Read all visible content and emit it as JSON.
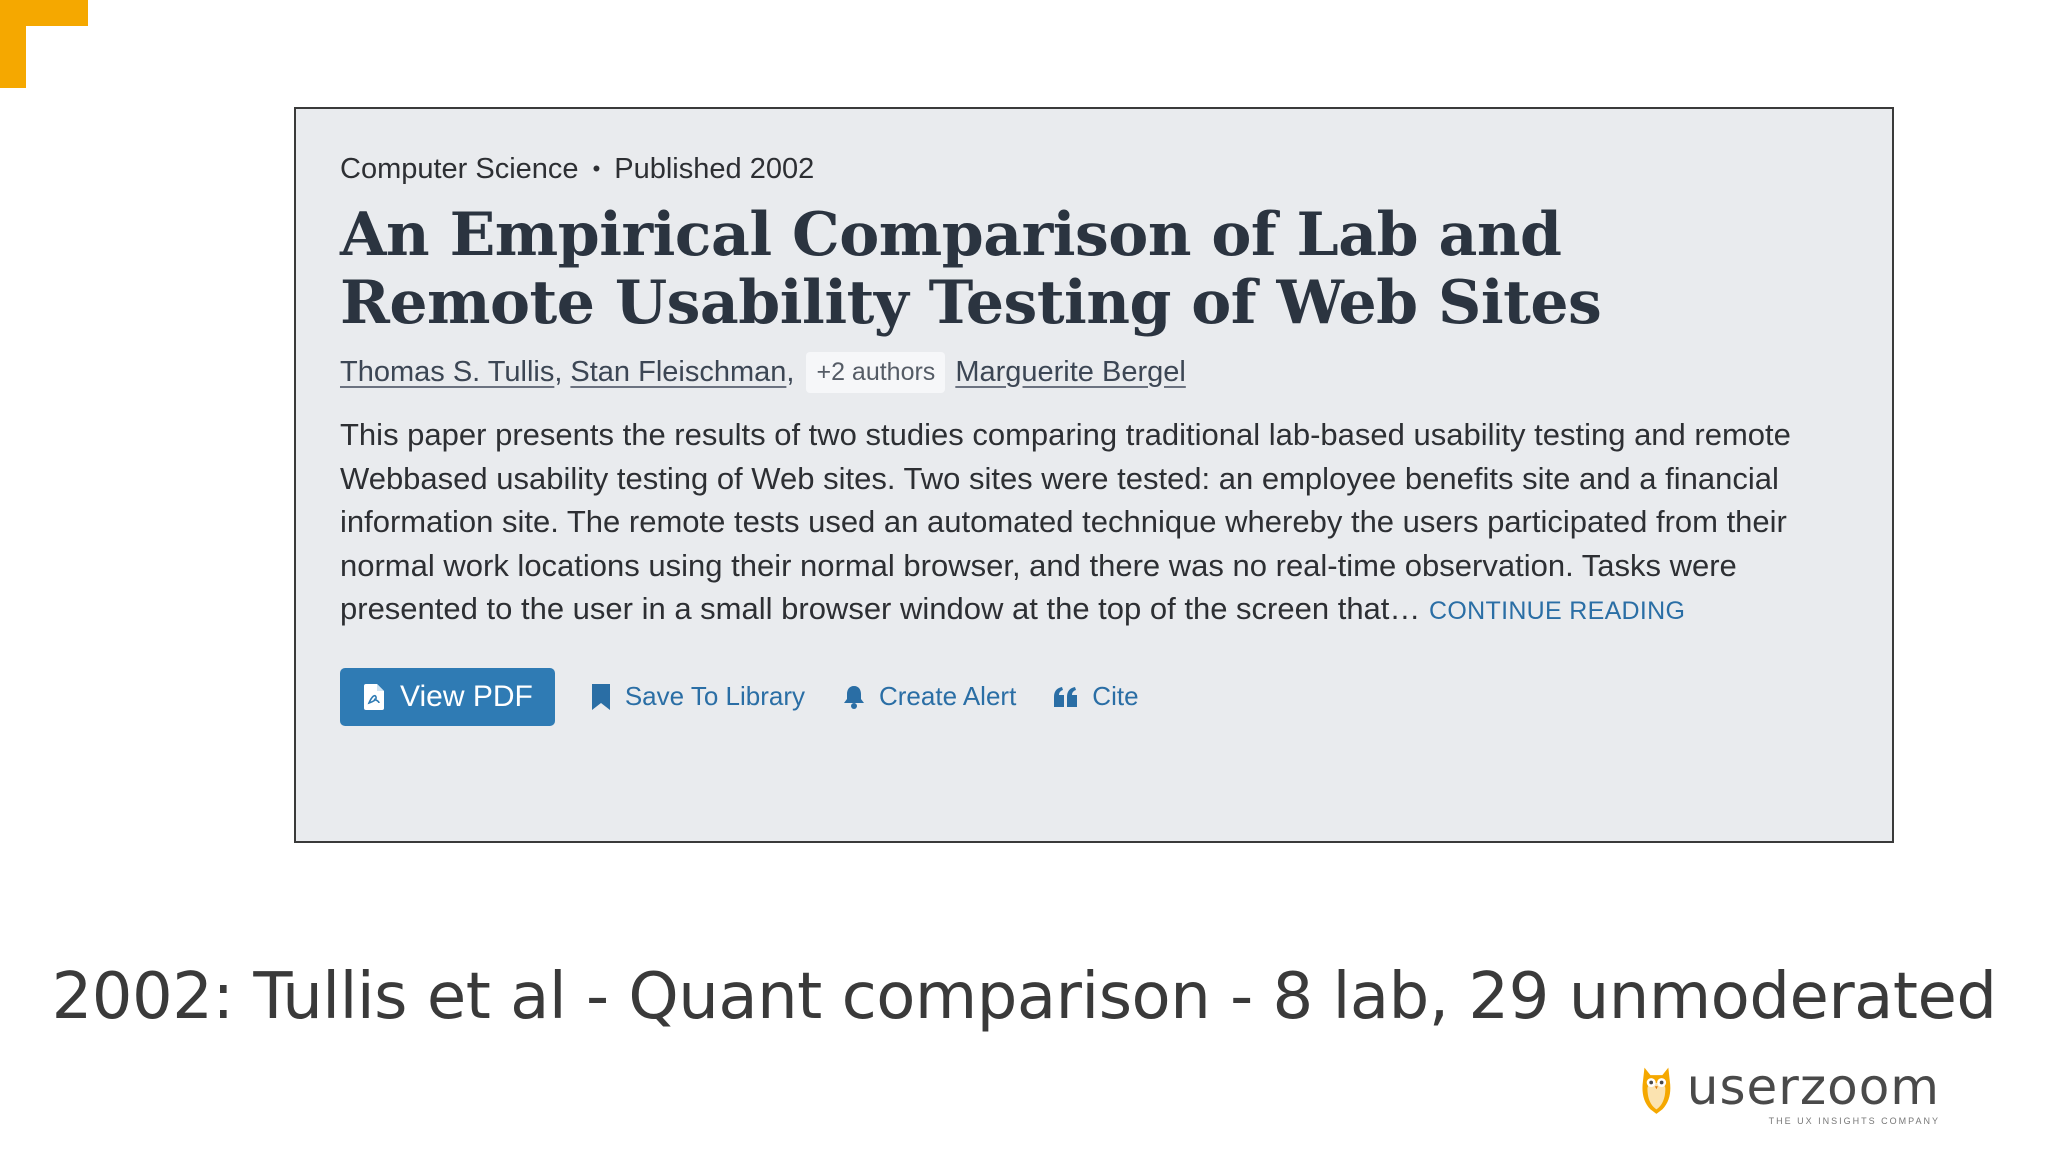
{
  "paper": {
    "field": "Computer Science",
    "separator": "•",
    "published": "Published 2002",
    "title": "An Empirical Comparison of Lab and Remote Usability Testing of Web Sites",
    "authors": [
      {
        "name": "Thomas S. Tullis",
        "sep": ","
      },
      {
        "name": "Stan Fleischman",
        "sep": ","
      }
    ],
    "more_authors": "+2 authors",
    "last_author": "Marguerite Bergel",
    "abstract": "This paper presents the results of two studies comparing traditional lab-based usability testing and remote Webbased usability testing of Web sites. Two sites were tested: an employee benefits site and a financial information site. The remote tests used an automated technique whereby the users participated from their normal work locations using their normal browser, and there was no real-time observation. Tasks were presented to the user in a small browser window at the top of the screen that…",
    "continue_label": "Continue Reading"
  },
  "actions": {
    "view_pdf": "View PDF",
    "save": "Save To Library",
    "alert": "Create Alert",
    "cite": "Cite"
  },
  "icons": {
    "pdf": "pdf-file-icon",
    "save": "bookmark-icon",
    "alert": "bell-icon",
    "cite": "quote-icon"
  },
  "caption": "2002: Tullis et al - Quant comparison - 8 lab, 29 unmoderated",
  "logo": {
    "word": "userzoom",
    "tagline": "THE UX INSIGHTS COMPANY"
  },
  "colors": {
    "accent_orange": "#f5a800",
    "link_blue": "#2a6ea5",
    "button_blue": "#2f7bb4",
    "card_bg": "#e9ebee"
  }
}
